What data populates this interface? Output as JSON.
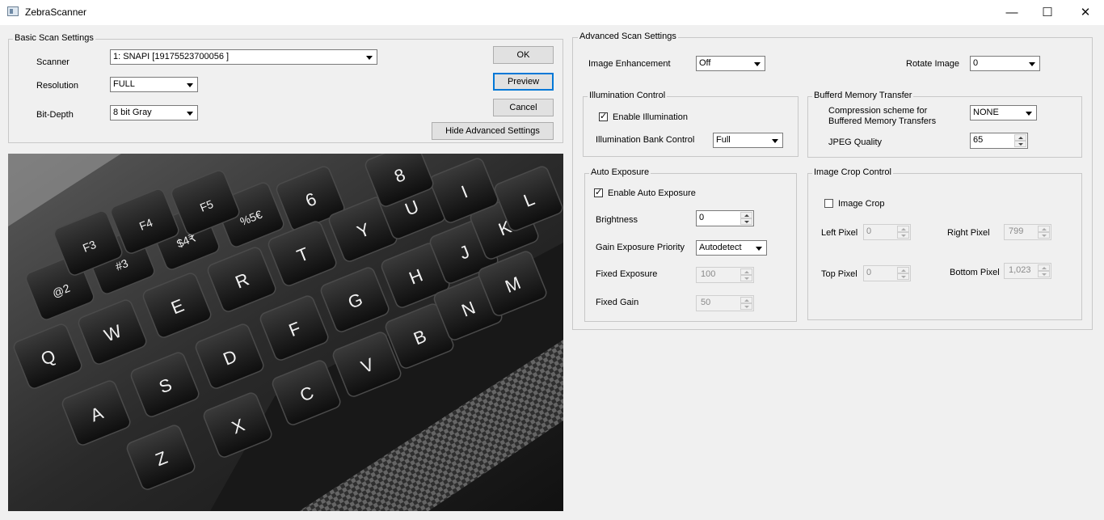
{
  "window": {
    "title": "ZebraScanner",
    "controls": {
      "minimize": "—",
      "maximize": "☐",
      "close": "✕"
    }
  },
  "basic": {
    "group_label": "Basic Scan Settings",
    "scanner_label": "Scanner",
    "scanner_value": "1: SNAPI [19175523700056  ]",
    "resolution_label": "Resolution",
    "resolution_value": "FULL",
    "bitdepth_label": "Bit-Depth",
    "bitdepth_value": "8 bit Gray",
    "ok_label": "OK",
    "preview_label": "Preview",
    "cancel_label": "Cancel",
    "hide_advanced_label": "Hide Advanced Settings"
  },
  "preview_image": {
    "icon": "keyboard-photo",
    "keys": [
      "@2",
      "#3",
      "$4₹",
      "%5€",
      "6",
      "F3",
      "F4",
      "F5",
      "Q",
      "W",
      "E",
      "R",
      "T",
      "Y",
      "U",
      "A",
      "S",
      "D",
      "F",
      "G",
      "H",
      "J",
      "K",
      "Z",
      "X",
      "C",
      "V",
      "B",
      "N",
      "M",
      "I",
      "8",
      "L"
    ]
  },
  "advanced": {
    "group_label": "Advanced Scan Settings",
    "image_enhancement_label": "Image Enhancement",
    "image_enhancement_value": "Off",
    "rotate_label": "Rotate Image",
    "rotate_value": "0",
    "illumination": {
      "group_label": "Illumination Control",
      "enable_label": "Enable Illumination",
      "enable_checked": true,
      "bank_label": "Illumination Bank Control",
      "bank_value": "Full"
    },
    "buffered": {
      "group_label": "Bufferd Memory Transfer",
      "compression_label_1": "Compression scheme for",
      "compression_label_2": "Buffered Memory Transfers",
      "compression_value": "NONE",
      "jpeg_label": "JPEG Quality",
      "jpeg_value": "65"
    },
    "auto_exposure": {
      "group_label": "Auto Exposure",
      "enable_label": "Enable Auto Exposure",
      "enable_checked": true,
      "brightness_label": "Brightness",
      "brightness_value": "0",
      "gain_priority_label": "Gain Exposure Priority",
      "gain_priority_value": "Autodetect",
      "fixed_exposure_label": "Fixed Exposure",
      "fixed_exposure_value": "100",
      "fixed_gain_label": "Fixed Gain",
      "fixed_gain_value": "50"
    },
    "crop": {
      "group_label": "Image Crop Control",
      "crop_label": "Image Crop",
      "crop_checked": false,
      "left_label": "Left Pixel",
      "left_value": "0",
      "right_label": "Right Pixel",
      "right_value": "799",
      "top_label": "Top Pixel",
      "top_value": "0",
      "bottom_label": "Bottom Pixel",
      "bottom_value": "1,023"
    }
  }
}
